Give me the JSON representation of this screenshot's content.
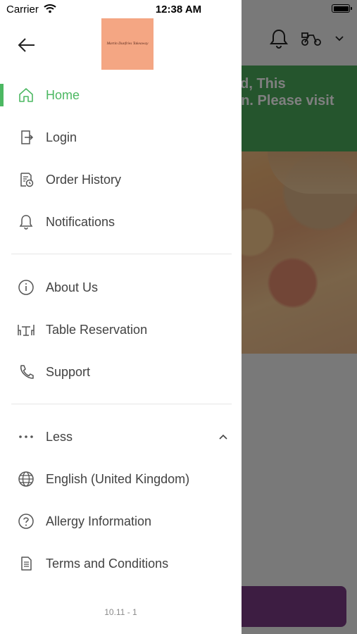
{
  "status_bar": {
    "carrier": "Carrier",
    "time": "12:38 AM"
  },
  "logo": {
    "text": "Martin Dunfries Takeaway"
  },
  "background": {
    "banner_text": "ed, This\non. Please visit\ny"
  },
  "menu": {
    "home": "Home",
    "login": "Login",
    "order_history": "Order History",
    "notifications": "Notifications",
    "about_us": "About Us",
    "table_reservation": "Table Reservation",
    "support": "Support",
    "less": "Less",
    "language": "English (United Kingdom)",
    "allergy": "Allergy Information",
    "terms": "Terms and Conditions"
  },
  "version": "10.11 - 1",
  "colors": {
    "accent": "#4cb862",
    "banner": "#4aaa5b",
    "cta": "#7a3b85"
  }
}
